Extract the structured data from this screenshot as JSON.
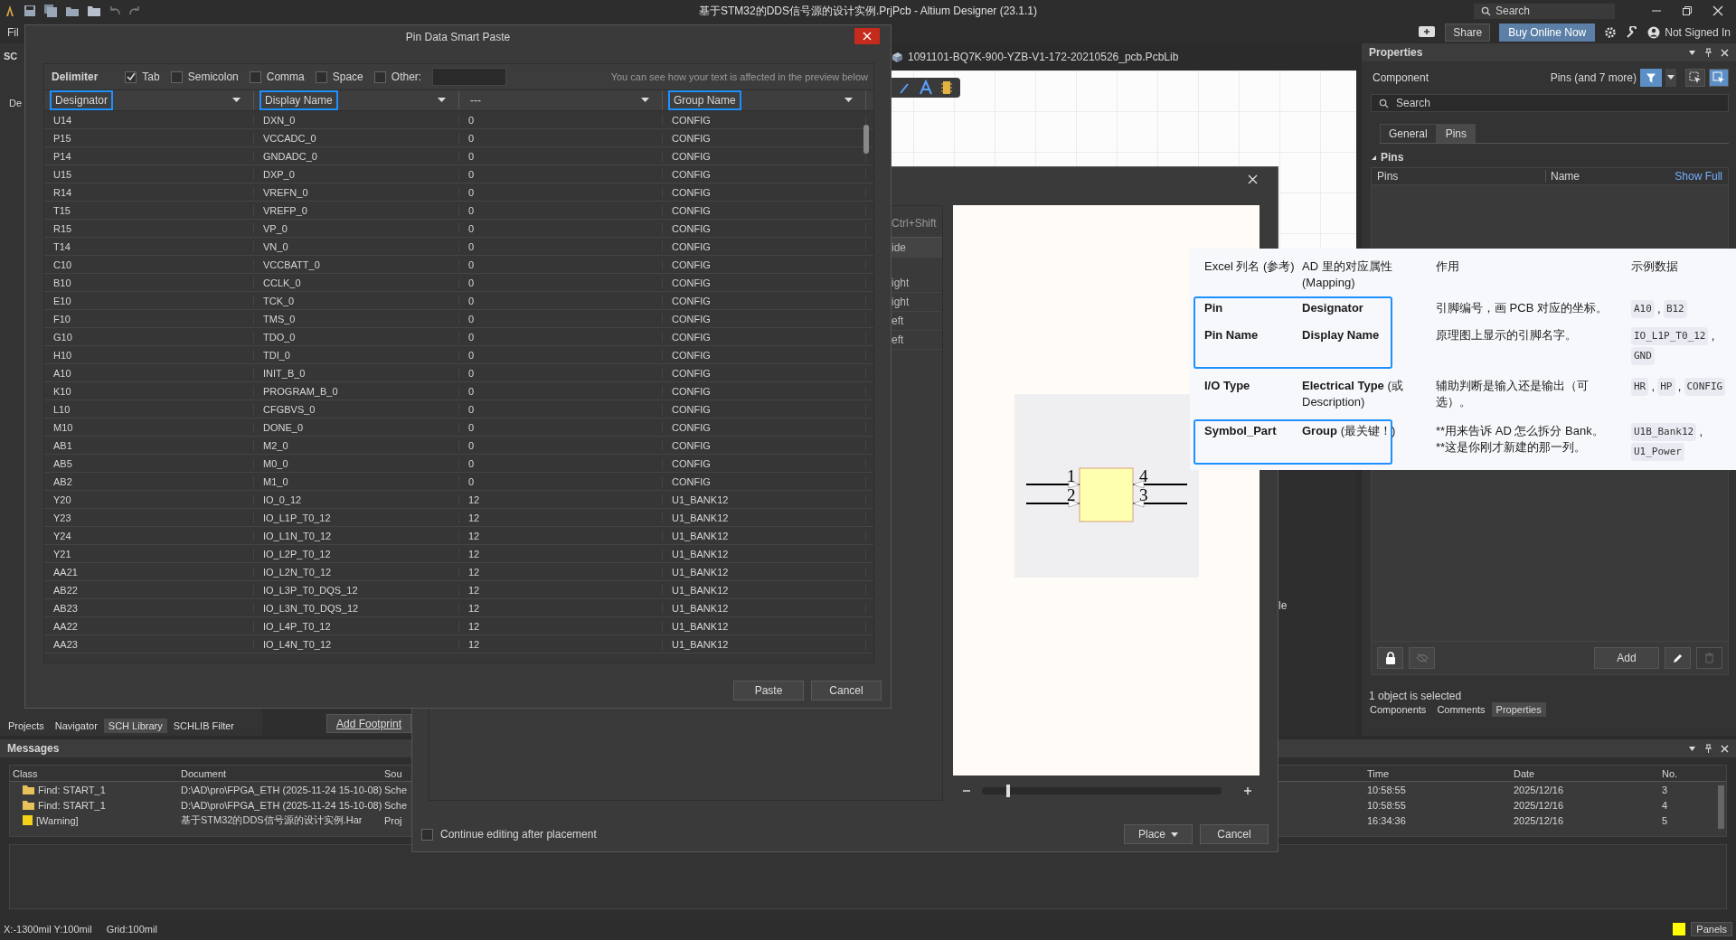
{
  "window": {
    "title": "基于STM32的DDS信号源的设计实例.PrjPcb - Altium Designer (23.1.1)"
  },
  "menu": [
    "Fil"
  ],
  "toolbar": {
    "search_placeholder": "Search",
    "share": "Share",
    "buy": "Buy Online Now",
    "account": "Not Signed In"
  },
  "left_panel": {
    "title": "SC",
    "label": "De",
    "tabs": [
      {
        "label": "Projects",
        "selected": false
      },
      {
        "label": "Navigator",
        "selected": false
      },
      {
        "label": "SCH Library",
        "selected": true
      },
      {
        "label": "SCHLIB Filter",
        "selected": false
      }
    ]
  },
  "document": {
    "tab": "1091101-BQ7K-900-YZB-V1-172-20210526_pcb.PcbLib",
    "fragment": "le",
    "add_footprint": "Add Footprint"
  },
  "pin_paste_dialog": {
    "title": "Pin Data Smart Paste",
    "delimiter_label": "Delimiter",
    "delimiters": [
      {
        "label": "Tab",
        "checked": true
      },
      {
        "label": "Semicolon",
        "checked": false
      },
      {
        "label": "Comma",
        "checked": false
      },
      {
        "label": "Space",
        "checked": false
      },
      {
        "label": "Other:",
        "checked": false
      }
    ],
    "hint": "You can see how your text is affected in the preview below",
    "columns": [
      {
        "label": "Designator",
        "mapped": true
      },
      {
        "label": "Display Name",
        "mapped": true
      },
      {
        "label": "---",
        "mapped": false
      },
      {
        "label": "Group Name",
        "mapped": true
      }
    ],
    "rows": [
      [
        "U14",
        "DXN_0",
        "0",
        "CONFIG"
      ],
      [
        "P15",
        "VCCADC_0",
        "0",
        "CONFIG"
      ],
      [
        "P14",
        "GNDADC_0",
        "0",
        "CONFIG"
      ],
      [
        "U15",
        "DXP_0",
        "0",
        "CONFIG"
      ],
      [
        "R14",
        "VREFN_0",
        "0",
        "CONFIG"
      ],
      [
        "T15",
        "VREFP_0",
        "0",
        "CONFIG"
      ],
      [
        "R15",
        "VP_0",
        "0",
        "CONFIG"
      ],
      [
        "T14",
        "VN_0",
        "0",
        "CONFIG"
      ],
      [
        "C10",
        "VCCBATT_0",
        "0",
        "CONFIG"
      ],
      [
        "B10",
        "CCLK_0",
        "0",
        "CONFIG"
      ],
      [
        "E10",
        "TCK_0",
        "0",
        "CONFIG"
      ],
      [
        "F10",
        "TMS_0",
        "0",
        "CONFIG"
      ],
      [
        "G10",
        "TDO_0",
        "0",
        "CONFIG"
      ],
      [
        "H10",
        "TDI_0",
        "0",
        "CONFIG"
      ],
      [
        "A10",
        "INIT_B_0",
        "0",
        "CONFIG"
      ],
      [
        "K10",
        "PROGRAM_B_0",
        "0",
        "CONFIG"
      ],
      [
        "L10",
        "CFGBVS_0",
        "0",
        "CONFIG"
      ],
      [
        "M10",
        "DONE_0",
        "0",
        "CONFIG"
      ],
      [
        "AB1",
        "M2_0",
        "0",
        "CONFIG"
      ],
      [
        "AB5",
        "M0_0",
        "0",
        "CONFIG"
      ],
      [
        "AB2",
        "M1_0",
        "0",
        "CONFIG"
      ],
      [
        "Y20",
        "IO_0_12",
        "12",
        "U1_BANK12"
      ],
      [
        "Y23",
        "IO_L1P_T0_12",
        "12",
        "U1_BANK12"
      ],
      [
        "Y24",
        "IO_L1N_T0_12",
        "12",
        "U1_BANK12"
      ],
      [
        "Y21",
        "IO_L2P_T0_12",
        "12",
        "U1_BANK12"
      ],
      [
        "AA21",
        "IO_L2N_T0_12",
        "12",
        "U1_BANK12"
      ],
      [
        "AB22",
        "IO_L3P_T0_DQS_12",
        "12",
        "U1_BANK12"
      ],
      [
        "AB23",
        "IO_L3N_T0_DQS_12",
        "12",
        "U1_BANK12"
      ],
      [
        "AA22",
        "IO_L4P_T0_12",
        "12",
        "U1_BANK12"
      ],
      [
        "AA23",
        "IO_L4N_T0_12",
        "12",
        "U1_BANK12"
      ]
    ],
    "buttons": [
      "Paste",
      "Cancel"
    ]
  },
  "place_dialog": {
    "list_items": [
      {
        "label": "Ctrl+Shift",
        "kind": "hint"
      },
      {
        "label": "ide",
        "kind": "header"
      },
      {
        "label": "ight",
        "kind": "item"
      },
      {
        "label": "ight",
        "kind": "item"
      },
      {
        "label": "eft",
        "kind": "item"
      },
      {
        "label": "eft",
        "kind": "item"
      }
    ],
    "pins": [
      "1",
      "2",
      "4",
      "3"
    ],
    "zoom": {
      "level": 0.1
    },
    "continue": {
      "label": "Continue editing after placement",
      "checked": false
    },
    "buttons": [
      {
        "label": "Place",
        "kind": "dropdown"
      },
      {
        "label": "Cancel",
        "kind": "plain"
      }
    ]
  },
  "mapping_table": {
    "example_separator": ",",
    "columns": [
      "Excel 列名 (参考)",
      "AD 里的对应属性 (Mapping)",
      "作用",
      "示例数据"
    ],
    "rows": [
      {
        "excel": "Pin",
        "property": "Designator",
        "purpose": "引脚编号，画 PCB 对应的坐标。",
        "examples": [
          "A10",
          "B12"
        ],
        "highlighted": true
      },
      {
        "excel": "Pin Name",
        "property": "Display Name",
        "purpose": "原理图上显示的引脚名字。",
        "examples": [
          "IO_L1P_T0_12",
          "GND"
        ],
        "highlighted": true
      },
      {
        "excel": "I/O Type",
        "property": "Electrical Type",
        "note": "(或 Description)",
        "purpose": "辅助判断是输入还是输出（可选）。",
        "examples": [
          "HR",
          "HP",
          "CONFIG"
        ],
        "highlighted": false
      },
      {
        "excel": "Symbol_Part",
        "property": "Group",
        "note": "(最关键！)",
        "purpose": "**用来告诉 AD 怎么拆分 Bank。\n**这是你刚才新建的那一列。",
        "examples": [
          "U1B_Bank12",
          "U1_Power"
        ],
        "highlighted": true
      }
    ]
  },
  "properties": {
    "title": "Properties",
    "component_label": "Component",
    "filter_text": "Pins (and 7 more)",
    "search_placeholder": "Search",
    "tabs": [
      {
        "label": "General",
        "selected": false
      },
      {
        "label": "Pins",
        "selected": true
      }
    ],
    "section": "Pins",
    "grid_columns": [
      "Pins",
      "Name"
    ],
    "show_full": "Show Full",
    "add_button": "Add",
    "selection_status": "1 object is selected",
    "bottom_tabs": [
      {
        "label": "Components",
        "selected": false
      },
      {
        "label": "Comments",
        "selected": false
      },
      {
        "label": "Properties",
        "selected": true
      }
    ]
  },
  "messages": {
    "title": "Messages",
    "columns": [
      "Class",
      "Document",
      "Sou",
      "Time",
      "Date",
      "No."
    ],
    "rows": [
      {
        "kind": "find",
        "class": "Find: START_1",
        "document": "D:\\AD\\pro\\FPGA_ETH (2025-11-24 15-10-08)",
        "source": "Sche",
        "time": "10:58:55",
        "date": "2025/12/16",
        "no": "3"
      },
      {
        "kind": "find",
        "class": "Find: START_1",
        "document": "D:\\AD\\pro\\FPGA_ETH (2025-11-24 15-10-08)",
        "source": "Sche",
        "time": "10:58:55",
        "date": "2025/12/16",
        "no": "4"
      },
      {
        "kind": "warning",
        "class": "[Warning]",
        "document": "基于STM32的DDS信号源的设计实例.Har",
        "source": "Proj",
        "time": "16:34:36",
        "date": "2025/12/16",
        "no": "5"
      }
    ]
  },
  "status_bar": {
    "coords": "X:-1300mil Y:100mil",
    "grid": "Grid:100mil",
    "panels": "Panels"
  }
}
